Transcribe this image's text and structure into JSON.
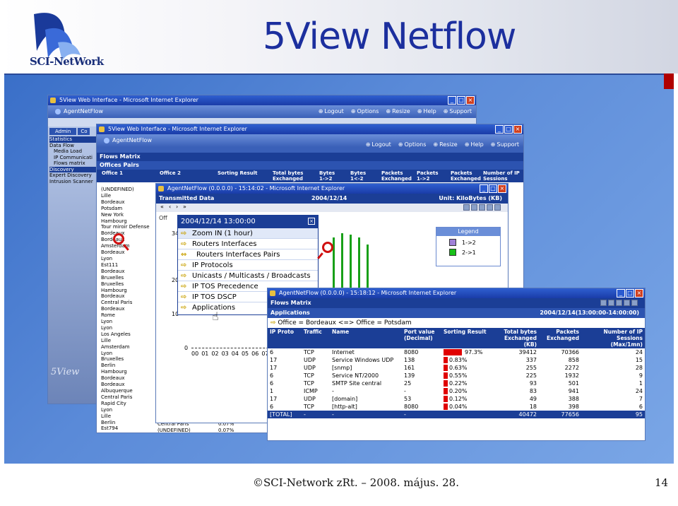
{
  "slide": {
    "title": "5View Netflow",
    "footer": "©SCI-Network zRt. – 2008. május. 28.",
    "page_number": "14",
    "logo_text": "SCI-NetWork"
  },
  "win1": {
    "title": "5View Web Interface - Microsoft Internet Explorer",
    "app": "AgentNetFlow",
    "nav": [
      "Logout",
      "Options",
      "Resize",
      "Help",
      "Support"
    ],
    "tabs": [
      "Admin",
      "Co"
    ],
    "sidebar": [
      "Statistics",
      "Data Flow",
      "Media Load",
      "IP Communicati",
      "Flows matrix",
      "Discovery",
      "Expert Discovery",
      "Intrusion Scanner"
    ],
    "brand": "5View"
  },
  "win2": {
    "title": "5View Web Interface - Microsoft Internet Explorer",
    "app": "AgentNetFlow",
    "nav": [
      "Logout",
      "Options",
      "Resize",
      "Help",
      "Support"
    ],
    "header1": "Flows Matrix",
    "header2": "Offices Pairs",
    "columns": [
      "Office 1",
      "Office 2",
      "Sorting Result",
      "Total bytes Exchanged",
      "Bytes 1->2",
      "Bytes 1<-2",
      "Packets Exchanged",
      "Packets 1->2",
      "Packets Exchanged",
      "Number of IP Sessions"
    ],
    "offices": [
      "(UNDEFINED)",
      "Lille",
      "Bordeaux",
      "Potsdam",
      "New York",
      "Hambourg",
      "Tour miroir Defense",
      "Bordeaux",
      "Bordeaux",
      "Amsterdam",
      "Bordeaux",
      "Lyon",
      "Est111",
      "Bordeaux",
      "Bruxelles",
      "Bruxelles",
      "Hambourg",
      "Bordeaux",
      "Central Paris",
      "Bordeaux",
      "Rome",
      "Lyon",
      "Lyon",
      "Los Angeles",
      "Lille",
      "Amsterdam",
      "Lyon",
      "Bruxelles",
      "Berlin",
      "Hambourg",
      "Bordeaux",
      "Bordeaux",
      "Albuquerque",
      "Central Paris",
      "Rapid City",
      "Lyon",
      "Lille",
      "Berlin",
      "Est794"
    ],
    "bottom_rows": [
      {
        "a": "Central Paris",
        "b": "0.07%"
      },
      {
        "a": "(UNDEFINED)",
        "b": "0.07%"
      }
    ]
  },
  "win3": {
    "title": "AgentNetFlow (0.0.0.0) - 15:14:02 - Microsoft Internet Explorer",
    "header": "Transmitted Data",
    "date": "2004/12/14",
    "unit": "Unit: KiloBytes (KB)",
    "y_ticks": [
      "34",
      "20",
      "10",
      "0"
    ],
    "x_ticks": [
      "00",
      "01",
      "02",
      "03",
      "04",
      "05",
      "06",
      "07"
    ],
    "menu_title": "2004/12/14 13:00:00",
    "menu_items": [
      "Zoom IN (1 hour)",
      "Routers Interfaces",
      "Routers Interfaces Pairs",
      "IP Protocols",
      "Unicasts / Multicasts / Broadcasts",
      "IP TOS Precedence",
      "IP TOS DSCP",
      "Applications"
    ],
    "legend_title": "Legend",
    "legend": [
      {
        "label": "1->2",
        "color": "#a080d8"
      },
      {
        "label": "2->1",
        "color": "#18c018"
      }
    ],
    "partial_label": "Off"
  },
  "win4": {
    "title": "AgentNetFlow (0.0.0.0) - 15:18:12 - Microsoft Internet Explorer",
    "header1": "Flows Matrix",
    "header2": "Applications",
    "date": "2004/12/14(13:00:00-14:00:00)",
    "filter": "Office = Bordeaux <=> Office = Potsdam",
    "columns": [
      "IP Proto",
      "Traffic",
      "Name",
      "Port value (Decimal)",
      "Sorting Result",
      "Total bytes Exchanged (KB)",
      "Packets Exchanged",
      "Number of IP Sessions (Max/1mn)"
    ],
    "rows": [
      {
        "proto": "6",
        "traffic": "TCP",
        "name": "Internet",
        "port": "8080",
        "pct": "97.3%",
        "pct_value": 97.3,
        "kb": "39412",
        "pk": "70366",
        "ses": "24"
      },
      {
        "proto": "17",
        "traffic": "UDP",
        "name": "Service Windows UDP",
        "port": "138",
        "pct": "0.83%",
        "pct_value": 0.83,
        "kb": "337",
        "pk": "858",
        "ses": "15"
      },
      {
        "proto": "17",
        "traffic": "UDP",
        "name": "[snmp]",
        "port": "161",
        "pct": "0.63%",
        "pct_value": 0.63,
        "kb": "255",
        "pk": "2272",
        "ses": "28"
      },
      {
        "proto": "6",
        "traffic": "TCP",
        "name": "Service NT/2000",
        "port": "139",
        "pct": "0.55%",
        "pct_value": 0.55,
        "kb": "225",
        "pk": "1932",
        "ses": "9"
      },
      {
        "proto": "6",
        "traffic": "TCP",
        "name": "SMTP Site central",
        "port": "25",
        "pct": "0.22%",
        "pct_value": 0.22,
        "kb": "93",
        "pk": "501",
        "ses": "1"
      },
      {
        "proto": "1",
        "traffic": "ICMP",
        "name": "-",
        "port": "-",
        "pct": "0.20%",
        "pct_value": 0.2,
        "kb": "83",
        "pk": "941",
        "ses": "24"
      },
      {
        "proto": "17",
        "traffic": "UDP",
        "name": "[domain]",
        "port": "53",
        "pct": "0.12%",
        "pct_value": 0.12,
        "kb": "49",
        "pk": "388",
        "ses": "7"
      },
      {
        "proto": "6",
        "traffic": "TCP",
        "name": "[http-alt]",
        "port": "8080",
        "pct": "0.04%",
        "pct_value": 0.04,
        "kb": "18",
        "pk": "398",
        "ses": "6"
      }
    ],
    "total": {
      "label": "[TOTAL]",
      "a": "-",
      "b": "-",
      "c": "-",
      "kb": "40472",
      "pk": "77656",
      "ses": "95"
    }
  }
}
